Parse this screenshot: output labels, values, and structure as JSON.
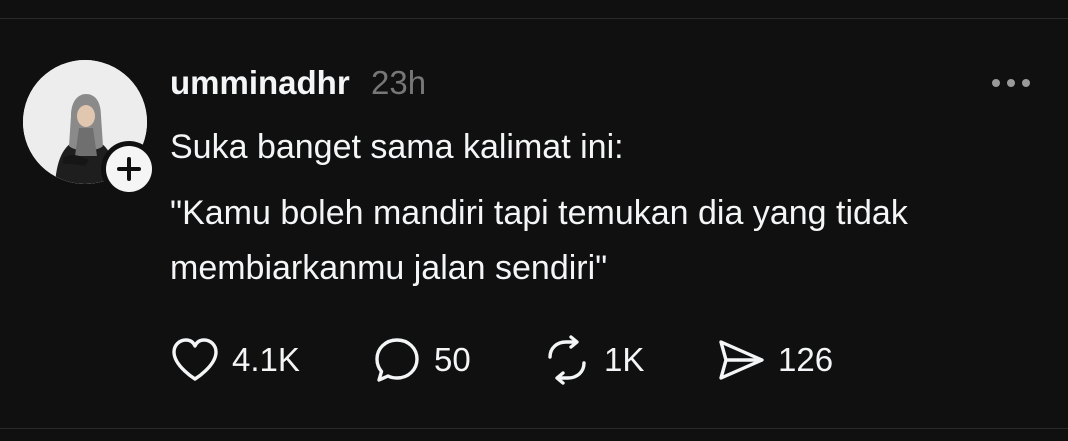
{
  "post": {
    "username": "umminadhr",
    "timestamp": "23h",
    "text_lines": [
      "Suka banget sama kalimat ini:",
      "\"Kamu boleh mandiri tapi temukan dia yang tidak",
      "membiarkanmu jalan sendiri\""
    ]
  },
  "actions": {
    "like": {
      "icon": "heart-icon",
      "count": "4.1K"
    },
    "reply": {
      "icon": "comment-icon",
      "count": "50"
    },
    "repost": {
      "icon": "repost-icon",
      "count": "1K"
    },
    "share": {
      "icon": "send-icon",
      "count": "126"
    }
  },
  "follow_badge": {
    "icon": "plus-icon"
  },
  "more": {
    "icon": "more-horizontal-icon"
  },
  "colors": {
    "background": "#101010",
    "text_primary": "#f3f5f7",
    "text_secondary": "#777777",
    "divider": "#2a2a2a"
  }
}
